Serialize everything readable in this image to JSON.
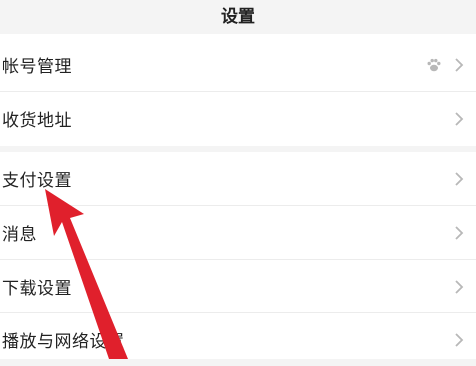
{
  "header": {
    "title": "设置"
  },
  "group1": {
    "items": [
      {
        "label": "帐号管理",
        "extra_icon": "paw-icon"
      },
      {
        "label": "收货地址"
      }
    ]
  },
  "group2": {
    "items": [
      {
        "label": "支付设置"
      },
      {
        "label": "消息"
      },
      {
        "label": "下载设置"
      },
      {
        "label": "播放与网络设置"
      }
    ]
  },
  "colors": {
    "background": "#f4f4f4",
    "row_background": "#ffffff",
    "arrow": "#e0202c",
    "chevron": "#b8b8b8"
  }
}
